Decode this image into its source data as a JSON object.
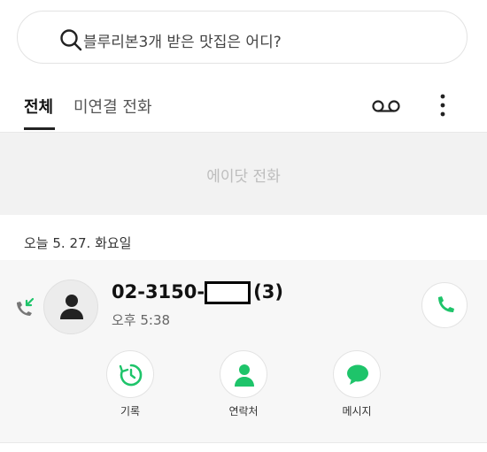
{
  "search": {
    "placeholder_text": "블루리본3개 받은 맛집은 어디?"
  },
  "tabs": [
    {
      "label": "전체",
      "active": true
    },
    {
      "label": "미연결 전화",
      "active": false
    }
  ],
  "toolbar": {
    "voicemail_icon": "voicemail-icon",
    "more_icon": "more-vert-icon"
  },
  "banner": {
    "text": "에이닷 전화"
  },
  "call_log": {
    "date_header": "오늘 5. 27. 화요일",
    "entries": [
      {
        "number_prefix": "02-3150-",
        "count": "(3)",
        "time": "오후 5:38",
        "call_type": "incoming"
      }
    ],
    "actions": [
      {
        "label": "기록",
        "icon": "history-icon"
      },
      {
        "label": "연락처",
        "icon": "contact-icon"
      },
      {
        "label": "메시지",
        "icon": "message-icon"
      }
    ]
  },
  "colors": {
    "accent_green": "#1ec46a",
    "banner_bg": "#f2f2f2",
    "card_bg": "#f7f7f7"
  }
}
